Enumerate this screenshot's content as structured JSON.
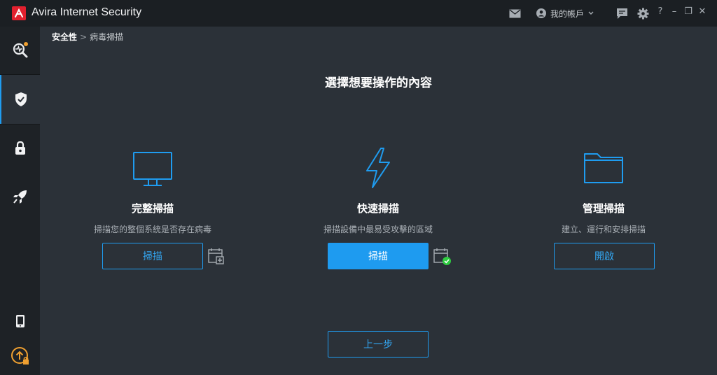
{
  "titlebar": {
    "app_title": "Avira Internet Security",
    "account_label": "我的帳戶",
    "help": "?",
    "minimize": "–",
    "restore": "❐",
    "close": "✕"
  },
  "breadcrumb": {
    "parent": "安全性",
    "separator": ">",
    "current": "病毒掃描"
  },
  "page_title": "選擇想要操作的內容",
  "options": [
    {
      "title": "完整掃描",
      "description": "掃描您的整個系統是否存在病毒",
      "button": "掃描",
      "icon": "monitor-icon"
    },
    {
      "title": "快速掃描",
      "description": "掃描設備中最易受攻擊的區域",
      "button": "掃描",
      "icon": "lightning-icon"
    },
    {
      "title": "管理掃描",
      "description": "建立、運行和安排掃描",
      "button": "開啟",
      "icon": "folder-icon"
    }
  ],
  "back_button": "上一步",
  "colors": {
    "accent": "#1e9bf0",
    "brand": "#e2202e",
    "background": "#2b3138",
    "sidebar": "#1e2226",
    "notify": "#f0a030",
    "ok": "#2ecc40"
  }
}
